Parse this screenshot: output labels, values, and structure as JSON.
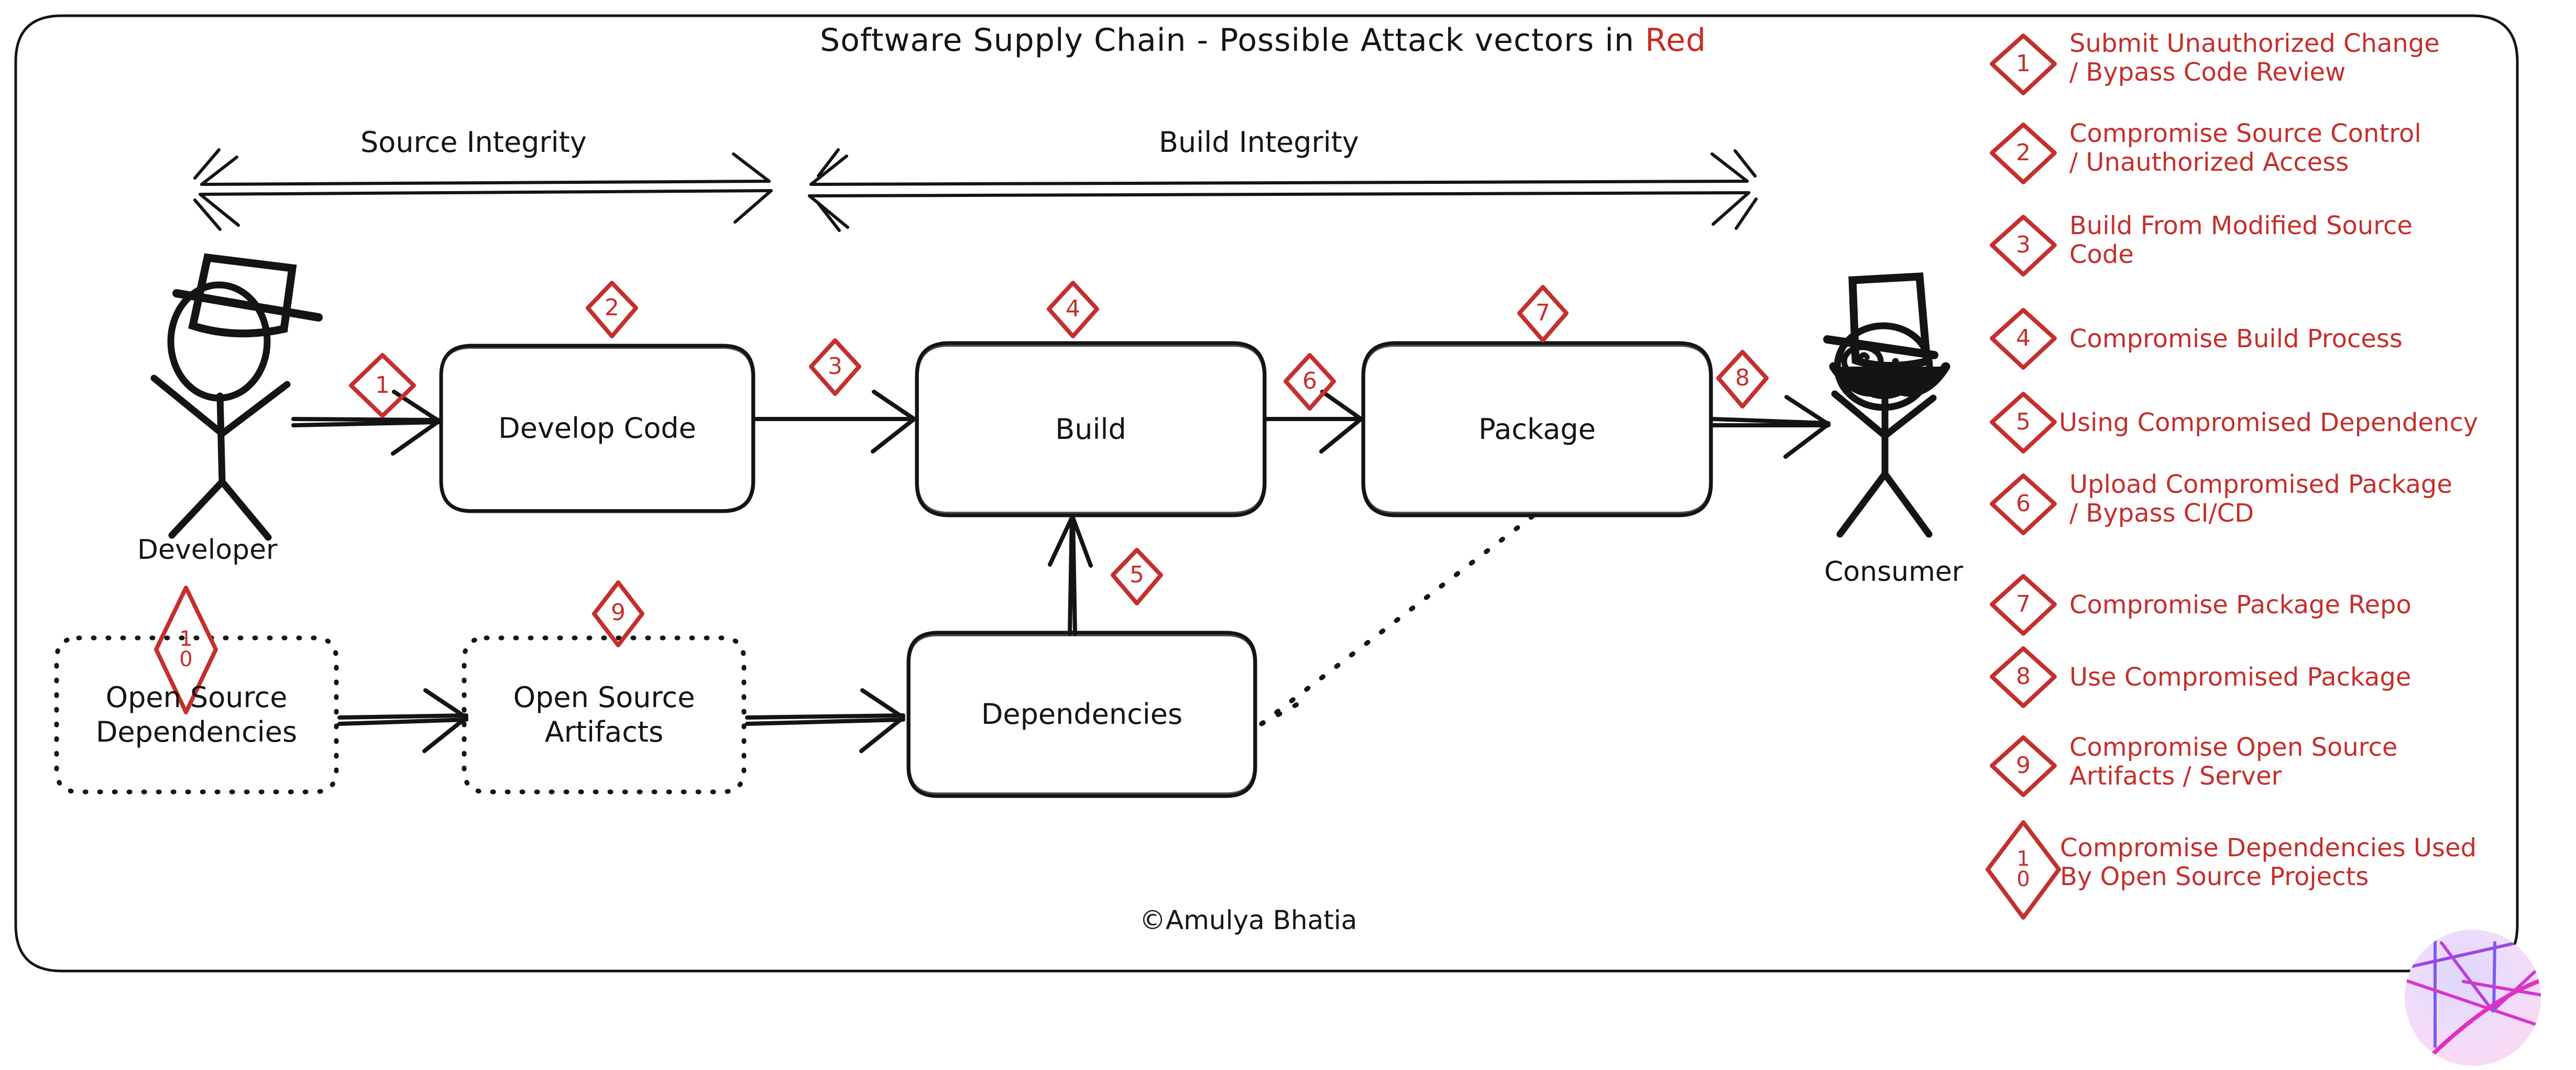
{
  "title": {
    "prefix": "Software Supply Chain - Possible Attack vectors in ",
    "highlight": "Red"
  },
  "bands": [
    {
      "id": "source-integrity",
      "label": "Source Integrity"
    },
    {
      "id": "build-integrity",
      "label": "Build Integrity"
    }
  ],
  "actors": [
    {
      "id": "developer",
      "label": "Developer"
    },
    {
      "id": "consumer",
      "label": "Consumer"
    }
  ],
  "nodes": [
    {
      "id": "develop-code",
      "label": "Develop Code",
      "style": "solid"
    },
    {
      "id": "build",
      "label": "Build",
      "style": "solid"
    },
    {
      "id": "package",
      "label": "Package",
      "style": "solid"
    },
    {
      "id": "open-source-dependencies",
      "label": "Open Source\nDependencies",
      "style": "dotted"
    },
    {
      "id": "open-source-artifacts",
      "label": "Open Source\nArtifacts",
      "style": "dotted"
    },
    {
      "id": "dependencies",
      "label": "Dependencies",
      "style": "solid"
    }
  ],
  "flow_markers": [
    {
      "id": "marker-1",
      "number": "1"
    },
    {
      "id": "marker-2",
      "number": "2"
    },
    {
      "id": "marker-3",
      "number": "3"
    },
    {
      "id": "marker-4",
      "number": "4"
    },
    {
      "id": "marker-5",
      "number": "5"
    },
    {
      "id": "marker-6",
      "number": "6"
    },
    {
      "id": "marker-7",
      "number": "7"
    },
    {
      "id": "marker-8",
      "number": "8"
    },
    {
      "id": "marker-9",
      "number": "9"
    },
    {
      "id": "marker-10",
      "number": "10"
    }
  ],
  "legend": [
    {
      "number": "1",
      "text": "Submit Unauthorized Change\n/ Bypass Code Review"
    },
    {
      "number": "2",
      "text": "Compromise Source Control\n/ Unauthorized Access"
    },
    {
      "number": "3",
      "text": "Build From Modified Source\nCode"
    },
    {
      "number": "4",
      "text": "Compromise Build Process"
    },
    {
      "number": "5",
      "text": "Using Compromised Dependency"
    },
    {
      "number": "6",
      "text": "Upload Compromised Package\n/ Bypass CI/CD"
    },
    {
      "number": "7",
      "text": "Compromise Package Repo"
    },
    {
      "number": "8",
      "text": "Use Compromised Package"
    },
    {
      "number": "9",
      "text": "Compromise Open Source\nArtifacts / Server"
    },
    {
      "number": "10",
      "text": "Compromise Dependencies Used\nBy Open Source Projects"
    }
  ],
  "credit": "©Amulya Bhatia",
  "colors": {
    "ink": "#141414",
    "attack_red": "#c52f2c",
    "background": "#ffffff",
    "watermark_violet": "#8a5cf0",
    "watermark_magenta": "#e33fd0"
  },
  "watermark": {
    "id": "author-logo-watermark"
  }
}
